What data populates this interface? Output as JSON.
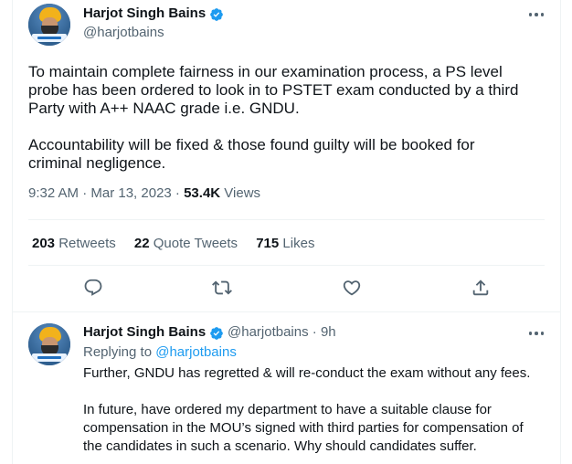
{
  "tweet": {
    "author_name": "Harjot Singh Bains",
    "author_handle": "@harjotbains",
    "text_lines": [
      "To maintain complete fairness in our examination process, a PS level",
      "probe has been ordered to look in to PSTET exam conducted by a third",
      "Party with A++ NAAC grade i.e. GNDU.",
      "Accountability will be fixed & those found guilty will be booked for",
      "criminal negligence."
    ],
    "time": "9:32 AM · Mar 13, 2023 · ",
    "views_count": "53.4K",
    "views_label": " Views",
    "retweets_count": "203",
    "retweets_label": "Retweets",
    "quotes_count": "22",
    "quotes_label": "Quote Tweets",
    "likes_count": "715",
    "likes_label": "Likes",
    "icons": [
      "reply-icon",
      "retweet-icon",
      "like-icon",
      "share-icon",
      "verified-icon",
      "more-icon"
    ]
  },
  "reply": {
    "author_name": "Harjot Singh Bains",
    "author_handle": "@harjotbains",
    "time": " · 9h",
    "replying_prefix": "Replying to ",
    "replying_handle": "@harjotbains",
    "text_lines": [
      "Further, GNDU has regretted & will re-conduct the exam without any fees.",
      "In future, have ordered my department to have a suitable clause for",
      "compensation in the MOU’s signed with third parties for compensation of",
      "the candidates in such a scenario. Why should candidates suffer."
    ]
  },
  "colors": {
    "accent": "#1d9bf0",
    "secondary_text": "#536471",
    "primary_text": "#0f1419",
    "divider": "#eff3f4"
  }
}
